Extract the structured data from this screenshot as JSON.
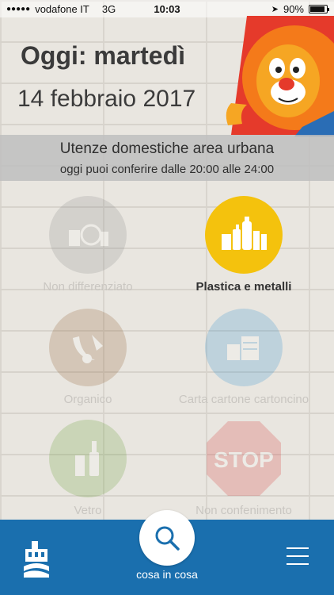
{
  "status_bar": {
    "carrier": "vodafone IT",
    "network": "3G",
    "time": "10:03",
    "battery": "90%"
  },
  "header": {
    "day": "Oggi: martedì",
    "date": "14 febbraio 2017"
  },
  "banner": {
    "title": "Utenze domestiche area urbana",
    "subtitle": "oggi puoi conferire dalle 20:00 alle 24:00"
  },
  "categories": [
    {
      "label": "Non differenziato",
      "active": false,
      "color": "#8a8a8a",
      "icon": "trash-icon"
    },
    {
      "label": "Plastica e metalli",
      "active": true,
      "color": "#f4c20d",
      "icon": "bottles-icon"
    },
    {
      "label": "Organico",
      "active": false,
      "color": "#8b5a2b",
      "icon": "banana-icon"
    },
    {
      "label": "Carta cartone cartoncino",
      "active": false,
      "color": "#2a8fd0",
      "icon": "paper-icon"
    },
    {
      "label": "Vetro",
      "active": false,
      "color": "#5f9a2c",
      "icon": "glass-bottle-icon"
    },
    {
      "label": "Non confenimento",
      "active": false,
      "color": "#d62f2f",
      "icon": "stop-sign-icon"
    }
  ],
  "stop_text": "STOP",
  "bottom_bar": {
    "search_label": "cosa in cosa",
    "background": "#1a6fae"
  }
}
